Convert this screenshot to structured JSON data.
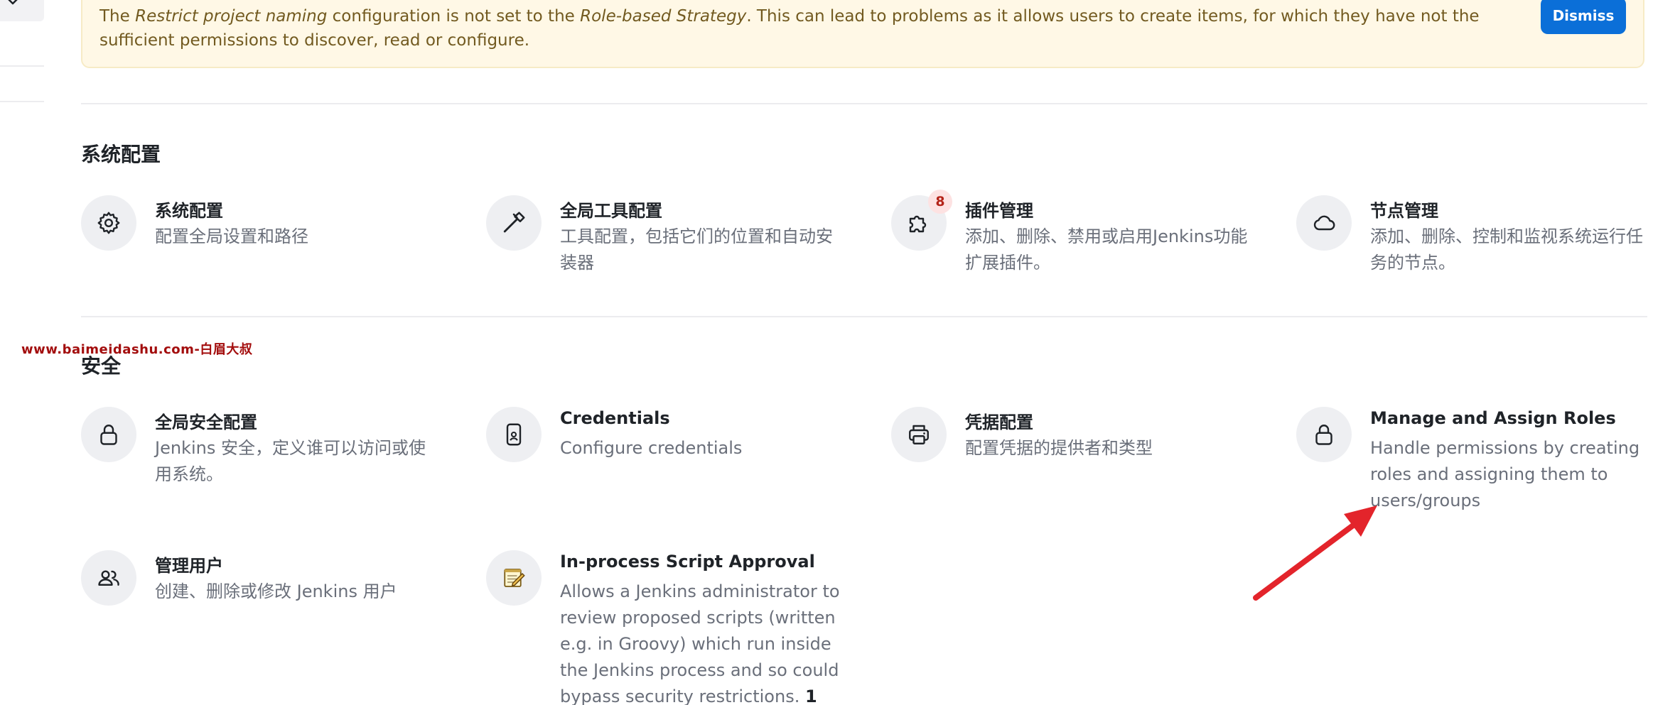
{
  "alert": {
    "part1": "The ",
    "italic1": "Restrict project naming",
    "part2": " configuration is not set to the ",
    "italic2": "Role-based Strategy",
    "part3": ". This can lead to problems as it allows users to create items, for which they have not the sufficient permissions to discover, read or configure.",
    "dismiss_label": "Dismiss"
  },
  "sections": {
    "system": {
      "title": "系统配置",
      "items": [
        {
          "title": "系统配置",
          "desc": "配置全局设置和路径",
          "icon": "gear-icon"
        },
        {
          "title": "全局工具配置",
          "desc": "工具配置，包括它们的位置和自动安装器",
          "icon": "hammer-icon"
        },
        {
          "title": "插件管理",
          "desc": "添加、删除、禁用或启用Jenkins功能扩展插件。",
          "icon": "puzzle-icon",
          "badge": "8"
        },
        {
          "title": "节点管理",
          "desc": "添加、删除、控制和监视系统运行任务的节点。",
          "icon": "cloud-icon"
        }
      ]
    },
    "security": {
      "title": "安全",
      "items": [
        {
          "title": "全局安全配置",
          "desc": "Jenkins 安全，定义谁可以访问或使用系统。",
          "icon": "lock-icon"
        },
        {
          "title": "Credentials",
          "desc": "Configure credentials",
          "icon": "phone-badge-icon"
        },
        {
          "title": "凭据配置",
          "desc": "配置凭据的提供者和类型",
          "icon": "printer-icon"
        },
        {
          "title": "Manage and Assign Roles",
          "desc": "Handle permissions by creating roles and assigning them to users/groups",
          "icon": "lock-icon"
        },
        {
          "title": "管理用户",
          "desc": "创建、删除或修改 Jenkins 用户",
          "icon": "users-icon"
        },
        {
          "title": "In-process Script Approval",
          "desc": "Allows a Jenkins administrator to review proposed scripts (written e.g. in Groovy) which run inside the Jenkins process and so could bypass security restrictions.",
          "desc_bold": "1",
          "icon": "notepad-icon"
        }
      ]
    }
  },
  "watermark": "www.baimeidashu.com-白眉大叔",
  "colors": {
    "dismiss": "#0b6fd8",
    "alert_bg": "#fff8e6",
    "badge_bg": "#fde2e2",
    "badge_text": "#b42318",
    "annotation_arrow": "#e3242b"
  }
}
